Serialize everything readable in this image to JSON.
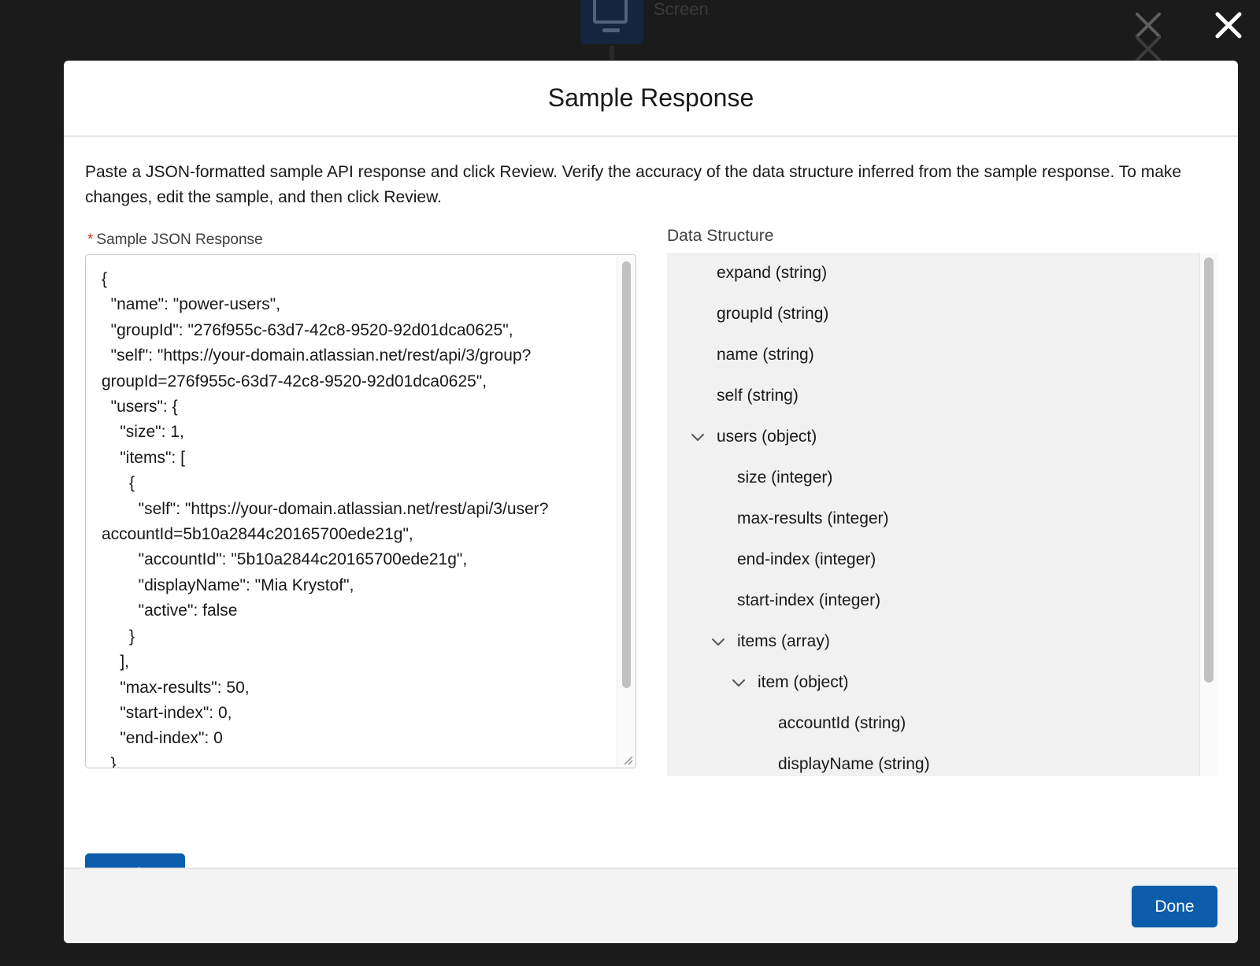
{
  "backdrop": {
    "label": "Screen"
  },
  "modal": {
    "title": "Sample Response",
    "description": "Paste a JSON-formatted sample API response and click Review. Verify the accuracy of the data structure inferred from the sample response. To make changes, edit the sample, and then click Review.",
    "json_field": {
      "required_mark": "*",
      "label": "Sample JSON Response",
      "value": "{\n  \"name\": \"power-users\",\n  \"groupId\": \"276f955c-63d7-42c8-9520-92d01dca0625\",\n  \"self\": \"https://your-domain.atlassian.net/rest/api/3/group?\ngroupId=276f955c-63d7-42c8-9520-92d01dca0625\",\n  \"users\": {\n    \"size\": 1,\n    \"items\": [\n      {\n        \"self\": \"https://your-domain.atlassian.net/rest/api/3/user?\naccountId=5b10a2844c20165700ede21g\",\n        \"accountId\": \"5b10a2844c20165700ede21g\",\n        \"displayName\": \"Mia Krystof\",\n        \"active\": false\n      }\n    ],\n    \"max-results\": 50,\n    \"start-index\": 0,\n    \"end-index\": 0\n  },"
    },
    "data_structure": {
      "label": "Data Structure",
      "items": [
        {
          "label": "expand (string)",
          "level": 0,
          "expandable": false
        },
        {
          "label": "groupId (string)",
          "level": 0,
          "expandable": false
        },
        {
          "label": "name (string)",
          "level": 0,
          "expandable": false
        },
        {
          "label": "self (string)",
          "level": 0,
          "expandable": false
        },
        {
          "label": "users (object)",
          "level": 0,
          "expandable": true
        },
        {
          "label": "size (integer)",
          "level": 1,
          "expandable": false
        },
        {
          "label": "max-results (integer)",
          "level": 1,
          "expandable": false
        },
        {
          "label": "end-index (integer)",
          "level": 1,
          "expandable": false
        },
        {
          "label": "start-index (integer)",
          "level": 1,
          "expandable": false
        },
        {
          "label": "items (array)",
          "level": 1,
          "expandable": true
        },
        {
          "label": "item (object)",
          "level": 2,
          "expandable": true
        },
        {
          "label": "accountId (string)",
          "level": 3,
          "expandable": false
        },
        {
          "label": "displayName (string)",
          "level": 3,
          "expandable": false
        }
      ]
    },
    "review_label": "Review",
    "done_label": "Done"
  },
  "colors": {
    "brand_button": "#0b5cab",
    "overlay": "#1b1b1b",
    "required": "#c23934"
  },
  "icons": {
    "close": "close-icon",
    "expand_chevron": "chevron-down-icon"
  }
}
